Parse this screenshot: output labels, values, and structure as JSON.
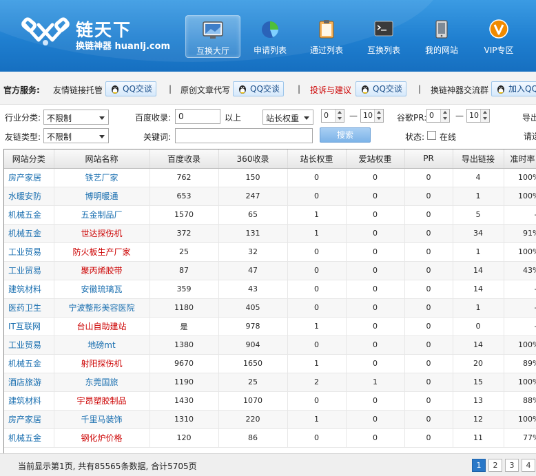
{
  "header": {
    "logo_title": "链天下",
    "logo_subtitle": "换链神器 huanlj.com",
    "nav": [
      {
        "label": "互换大厅",
        "icon": "screen-icon",
        "active": true
      },
      {
        "label": "申请列表",
        "icon": "pie-chart-icon",
        "active": false
      },
      {
        "label": "通过列表",
        "icon": "clipboard-icon",
        "active": false
      },
      {
        "label": "互换列表",
        "icon": "terminal-icon",
        "active": false
      },
      {
        "label": "我的网站",
        "icon": "phone-icon",
        "active": false
      },
      {
        "label": "VIP专区",
        "icon": "vip-badge-icon",
        "active": false
      }
    ],
    "colors": {
      "bar": "#1f7fd0",
      "vip": "#f08a00"
    }
  },
  "services": {
    "label": "官方服务:",
    "items": [
      {
        "text": "友情链接托管",
        "button": "QQ交谈"
      },
      {
        "text": "原创文章代写",
        "button": "QQ交谈"
      },
      {
        "text": "投诉与建议",
        "button": "QQ交谈",
        "color": "#cc0000"
      },
      {
        "text": "换链神器交流群",
        "button": "加入QQ"
      }
    ],
    "separator": "|"
  },
  "filters": {
    "industry_label": "行业分类:",
    "industry_value": "不限制",
    "linktype_label": "友链类型:",
    "linktype_value": "不限制",
    "baidu_label": "百度收录:",
    "baidu_value": "0",
    "baidu_suffix": "以上",
    "keyword_label": "关键词:",
    "keyword_value": "",
    "weight_select": "站长权重",
    "weight_min": "0",
    "weight_max": "10",
    "dash": "—",
    "pr_label": "谷歌PR:",
    "pr_min": "0",
    "pr_max": "10",
    "export_label": "导出",
    "please_label": "请选",
    "search_button": "搜索",
    "status_label": "状态:",
    "online_label": "在线"
  },
  "table": {
    "columns": [
      "网站分类",
      "网站名称",
      "百度收录",
      "360收录",
      "站长权重",
      "爱站权重",
      "PR",
      "导出链接",
      "准时率"
    ],
    "rows": [
      {
        "cat": "房产家居",
        "name": "铁艺厂家",
        "color": "blue",
        "baidu": "762",
        "s360": "150",
        "zz": "0",
        "az": "0",
        "pr": "0",
        "out": "4",
        "ratio": "100%"
      },
      {
        "cat": "水暖安防",
        "name": "博明暖通",
        "color": "blue",
        "baidu": "653",
        "s360": "247",
        "zz": "0",
        "az": "0",
        "pr": "0",
        "out": "1",
        "ratio": "100%"
      },
      {
        "cat": "机械五金",
        "name": "五金制品厂",
        "color": "blue",
        "baidu": "1570",
        "s360": "65",
        "zz": "1",
        "az": "0",
        "pr": "0",
        "out": "5",
        "ratio": "--"
      },
      {
        "cat": "机械五金",
        "name": "世达探伤机",
        "color": "red",
        "baidu": "372",
        "s360": "131",
        "zz": "1",
        "az": "0",
        "pr": "0",
        "out": "34",
        "ratio": "91%"
      },
      {
        "cat": "工业贸易",
        "name": "防火板生产厂家",
        "color": "red",
        "baidu": "25",
        "s360": "32",
        "zz": "0",
        "az": "0",
        "pr": "0",
        "out": "1",
        "ratio": "100%"
      },
      {
        "cat": "工业贸易",
        "name": "聚丙烯胶带",
        "color": "red",
        "baidu": "87",
        "s360": "47",
        "zz": "0",
        "az": "0",
        "pr": "0",
        "out": "14",
        "ratio": "43%"
      },
      {
        "cat": "建筑材料",
        "name": "安徽琉璃瓦",
        "color": "blue",
        "baidu": "359",
        "s360": "43",
        "zz": "0",
        "az": "0",
        "pr": "0",
        "out": "14",
        "ratio": "--"
      },
      {
        "cat": "医药卫生",
        "name": "宁波整形美容医院",
        "color": "blue",
        "baidu": "1180",
        "s360": "405",
        "zz": "0",
        "az": "0",
        "pr": "0",
        "out": "1",
        "ratio": "--"
      },
      {
        "cat": "IT互联网",
        "name": "台山自助建站",
        "color": "red",
        "baidu": "是",
        "s360": "978",
        "zz": "1",
        "az": "0",
        "pr": "0",
        "out": "0",
        "ratio": "--"
      },
      {
        "cat": "工业贸易",
        "name": "地磅mt",
        "color": "blue",
        "baidu": "1380",
        "s360": "904",
        "zz": "0",
        "az": "0",
        "pr": "0",
        "out": "14",
        "ratio": "100%"
      },
      {
        "cat": "机械五金",
        "name": "射阳探伤机",
        "color": "red",
        "baidu": "9670",
        "s360": "1650",
        "zz": "1",
        "az": "0",
        "pr": "0",
        "out": "20",
        "ratio": "89%"
      },
      {
        "cat": "酒店旅游",
        "name": "东莞国旅",
        "color": "blue",
        "baidu": "1190",
        "s360": "25",
        "zz": "2",
        "az": "1",
        "pr": "0",
        "out": "15",
        "ratio": "100%"
      },
      {
        "cat": "建筑材料",
        "name": "宇昂塑胶制品",
        "color": "red",
        "baidu": "1430",
        "s360": "1070",
        "zz": "0",
        "az": "0",
        "pr": "0",
        "out": "13",
        "ratio": "88%"
      },
      {
        "cat": "房产家居",
        "name": "千里马装饰",
        "color": "blue",
        "baidu": "1310",
        "s360": "220",
        "zz": "1",
        "az": "0",
        "pr": "0",
        "out": "12",
        "ratio": "100%"
      },
      {
        "cat": "机械五金",
        "name": "钢化炉价格",
        "color": "red",
        "baidu": "120",
        "s360": "86",
        "zz": "0",
        "az": "0",
        "pr": "0",
        "out": "11",
        "ratio": "77%"
      }
    ]
  },
  "footer": {
    "summary": "当前显示第1页, 共有85565条数据, 合计5705页",
    "pages": [
      "1",
      "2",
      "3",
      "4"
    ],
    "current_page": "1"
  }
}
